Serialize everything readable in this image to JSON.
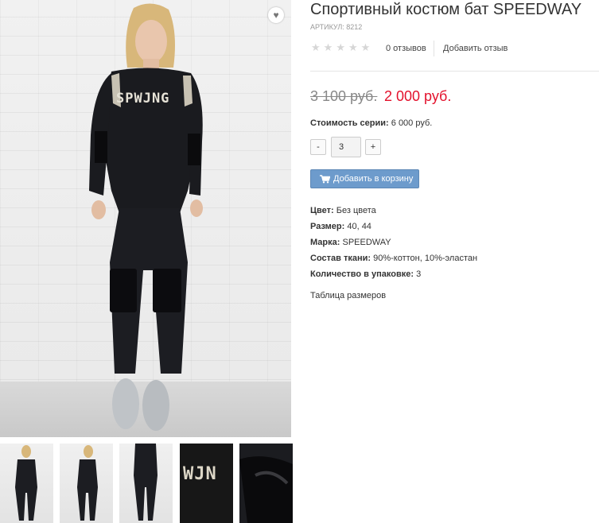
{
  "product": {
    "title": "Спортивный костюм бат SPEEDWAY",
    "sku_label": "АРТИКУЛ: 8212",
    "print_text": "SPWJNG"
  },
  "rating": {
    "stars_total": 5,
    "stars_filled": 0,
    "reviews_count_label": "0 отзывов",
    "add_review_label": "Добавить отзыв"
  },
  "price": {
    "old": "3 100 руб.",
    "new": "2 000 руб."
  },
  "series": {
    "label": "Стоимость серии:",
    "value": "6 000 руб."
  },
  "quantity": {
    "minus": "-",
    "value": "3",
    "plus": "+"
  },
  "cart_button": {
    "label": "Добавить в корзину",
    "icon": "cart-icon"
  },
  "properties": [
    {
      "label": "Цвет:",
      "value": "Без цвета"
    },
    {
      "label": "Размер:",
      "value": "40, 44"
    },
    {
      "label": "Марка:",
      "value": "SPEEDWAY"
    },
    {
      "label": "Состав ткани:",
      "value": "90%-коттон, 10%-эластан"
    },
    {
      "label": "Количество в упаковке:",
      "value": "3"
    }
  ],
  "size_table_label": "Таблица размеров",
  "wishlist_icon": "heart-icon",
  "colors": {
    "price_new": "#e3112c",
    "cart_button": "#6d9bcc"
  }
}
